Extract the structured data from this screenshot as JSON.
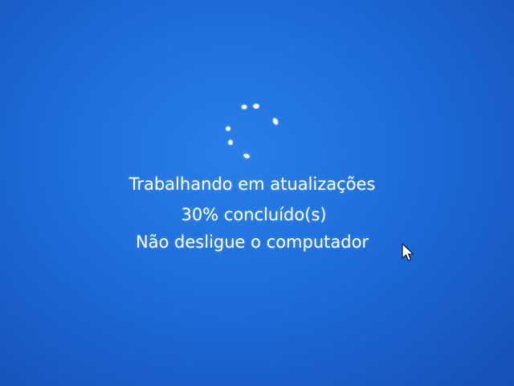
{
  "update_screen": {
    "status_line": "Trabalhando em atualizações",
    "progress_line": "30% concluído(s)",
    "warning_line": "Não desligue o computador",
    "progress_percent": 30
  },
  "colors": {
    "background": "#1f6fdc",
    "text": "#eaf3ff",
    "spinner_dot": "#eef7ff"
  },
  "icons": {
    "spinner": "loading-spinner-icon",
    "cursor": "mouse-pointer-icon"
  }
}
